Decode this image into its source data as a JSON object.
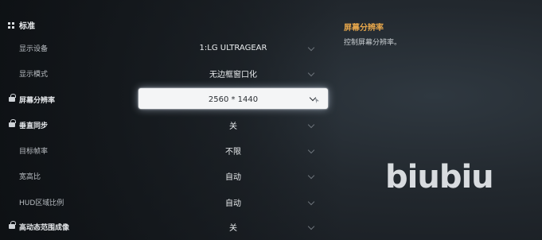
{
  "section": {
    "title": "标准",
    "icon": "grid-icon"
  },
  "settings": [
    {
      "label": "显示设备",
      "value": "1:LG ULTRAGEAR",
      "locked": false
    },
    {
      "label": "显示模式",
      "value": "无边框窗口化",
      "locked": false
    },
    {
      "label": "屏幕分辨率",
      "value": "2560 * 1440",
      "locked": true,
      "active": true
    },
    {
      "label": "垂直同步",
      "value": "关",
      "locked": true
    },
    {
      "label": "目标帧率",
      "value": "不限",
      "locked": false
    },
    {
      "label": "宽高比",
      "value": "自动",
      "locked": false
    },
    {
      "label": "HUD区域比例",
      "value": "自动",
      "locked": false
    },
    {
      "label": "高动态范围成像",
      "value": "关",
      "locked": true
    }
  ],
  "detail": {
    "title": "屏幕分辨率",
    "description": "控制屏幕分辨率。"
  },
  "watermark": "biubiu",
  "colors": {
    "accent": "#e6a64b",
    "active_dropdown": "#f4f5f6"
  }
}
